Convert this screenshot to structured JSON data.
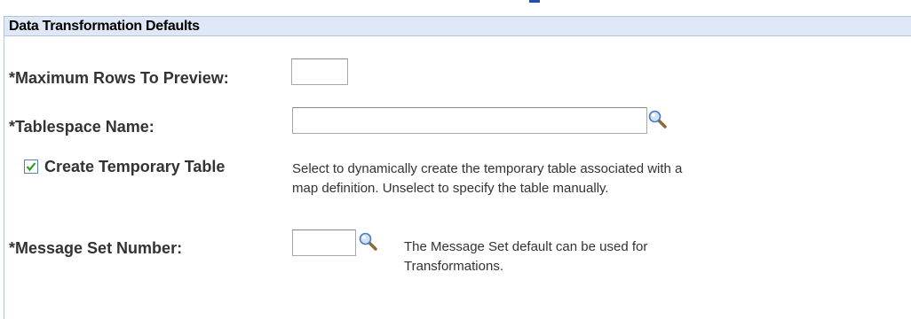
{
  "section": {
    "title": "Data Transformation Defaults"
  },
  "fields": {
    "max_rows": {
      "label": "*Maximum Rows To Preview:",
      "value": ""
    },
    "tablespace": {
      "label": "*Tablespace Name:",
      "value": ""
    },
    "create_temp_table": {
      "label": "Create Temporary Table",
      "checked": true,
      "help_line1": "Select to dynamically create the temporary table associated with a",
      "help_line2": "map definition. Unselect to specify the table manually."
    },
    "message_set": {
      "label": "*Message Set Number:",
      "value": "",
      "help_line1": "The Message Set default can be used for",
      "help_line2": "Transformations."
    }
  },
  "icons": {
    "lookup": "magnifying-glass-icon",
    "checkmark": "checkmark-icon"
  },
  "colors": {
    "header_bg": "#dfe8f6",
    "header_border": "#b5c4d8",
    "label_text": "#333333",
    "checkmark": "#2a9d2a"
  }
}
